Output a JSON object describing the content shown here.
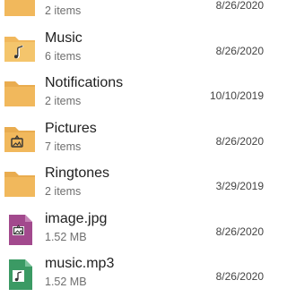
{
  "colors": {
    "folder": "#f1b85c",
    "image_file": "#a2498d",
    "audio_file": "#3b9a64"
  },
  "items": [
    {
      "name": "",
      "sub": "2 items",
      "date": "8/26/2020",
      "icon": "folder-icon"
    },
    {
      "name": "Music",
      "sub": "6 items",
      "date": "8/26/2020",
      "icon": "music-folder-icon"
    },
    {
      "name": "Notifications",
      "sub": "2 items",
      "date": "10/10/2019",
      "icon": "folder-icon"
    },
    {
      "name": "Pictures",
      "sub": "7 items",
      "date": "8/26/2020",
      "icon": "pictures-folder-icon"
    },
    {
      "name": "Ringtones",
      "sub": "2 items",
      "date": "3/29/2019",
      "icon": "folder-icon"
    },
    {
      "name": "image.jpg",
      "sub": "1.52 MB",
      "date": "8/26/2020",
      "icon": "image-file-icon"
    },
    {
      "name": "music.mp3",
      "sub": "1.52 MB",
      "date": "8/26/2020",
      "icon": "audio-file-icon"
    }
  ]
}
